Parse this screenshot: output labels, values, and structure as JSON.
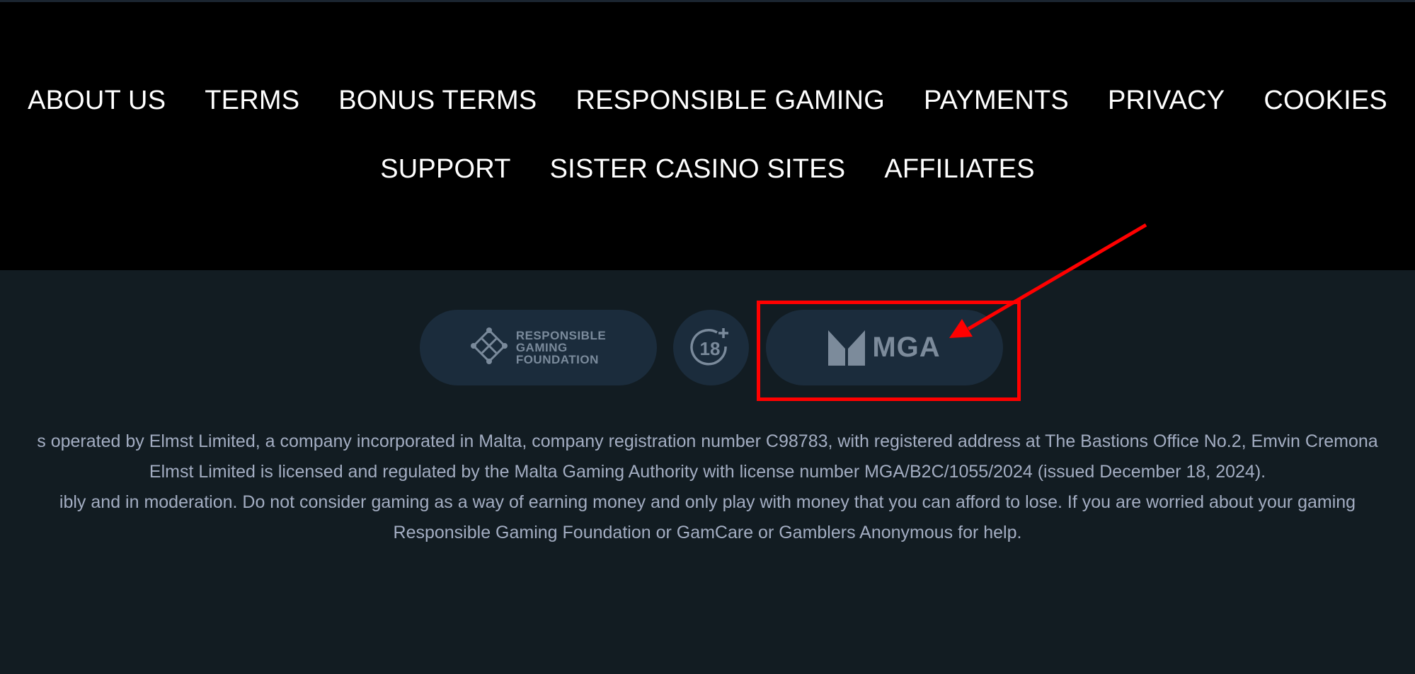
{
  "nav": {
    "row1": [
      "ABOUT US",
      "TERMS",
      "BONUS TERMS",
      "RESPONSIBLE GAMING",
      "PAYMENTS",
      "PRIVACY",
      "COOKIES"
    ],
    "row2": [
      "SUPPORT",
      "SISTER CASINO SITES",
      "AFFILIATES"
    ]
  },
  "badges": {
    "rgf": {
      "line1": "RESPONSIBLE",
      "line2": "GAMING",
      "line3": "FOUNDATION",
      "icon": "responsible-gaming-foundation-icon"
    },
    "age": {
      "label": "18",
      "icon": "age-18-plus-icon"
    },
    "mga": {
      "label": "MGA",
      "icon": "mga-logo-icon"
    }
  },
  "annotation": {
    "color": "#ff0000",
    "target": "mga-badge"
  },
  "legal": {
    "line1": "s operated by Elmst Limited, a company incorporated in Malta, company registration number C98783, with registered address at The Bastions Office No.2, Emvin Cremona",
    "line2": "Elmst Limited is licensed and regulated by the Malta Gaming Authority with license number MGA/B2C/1055/2024 (issued December 18, 2024).",
    "line3": "ibly and in moderation. Do not consider gaming as a way of earning money and only play with money that you can afford to lose. If you are worried about your gaming",
    "line4": "Responsible Gaming Foundation or GamCare or Gamblers Anonymous for help."
  },
  "colors": {
    "nav_bg": "#000000",
    "footer_bg": "#121c22",
    "badge_bg": "#1b2c3c",
    "legal_text": "#a3adc2"
  }
}
